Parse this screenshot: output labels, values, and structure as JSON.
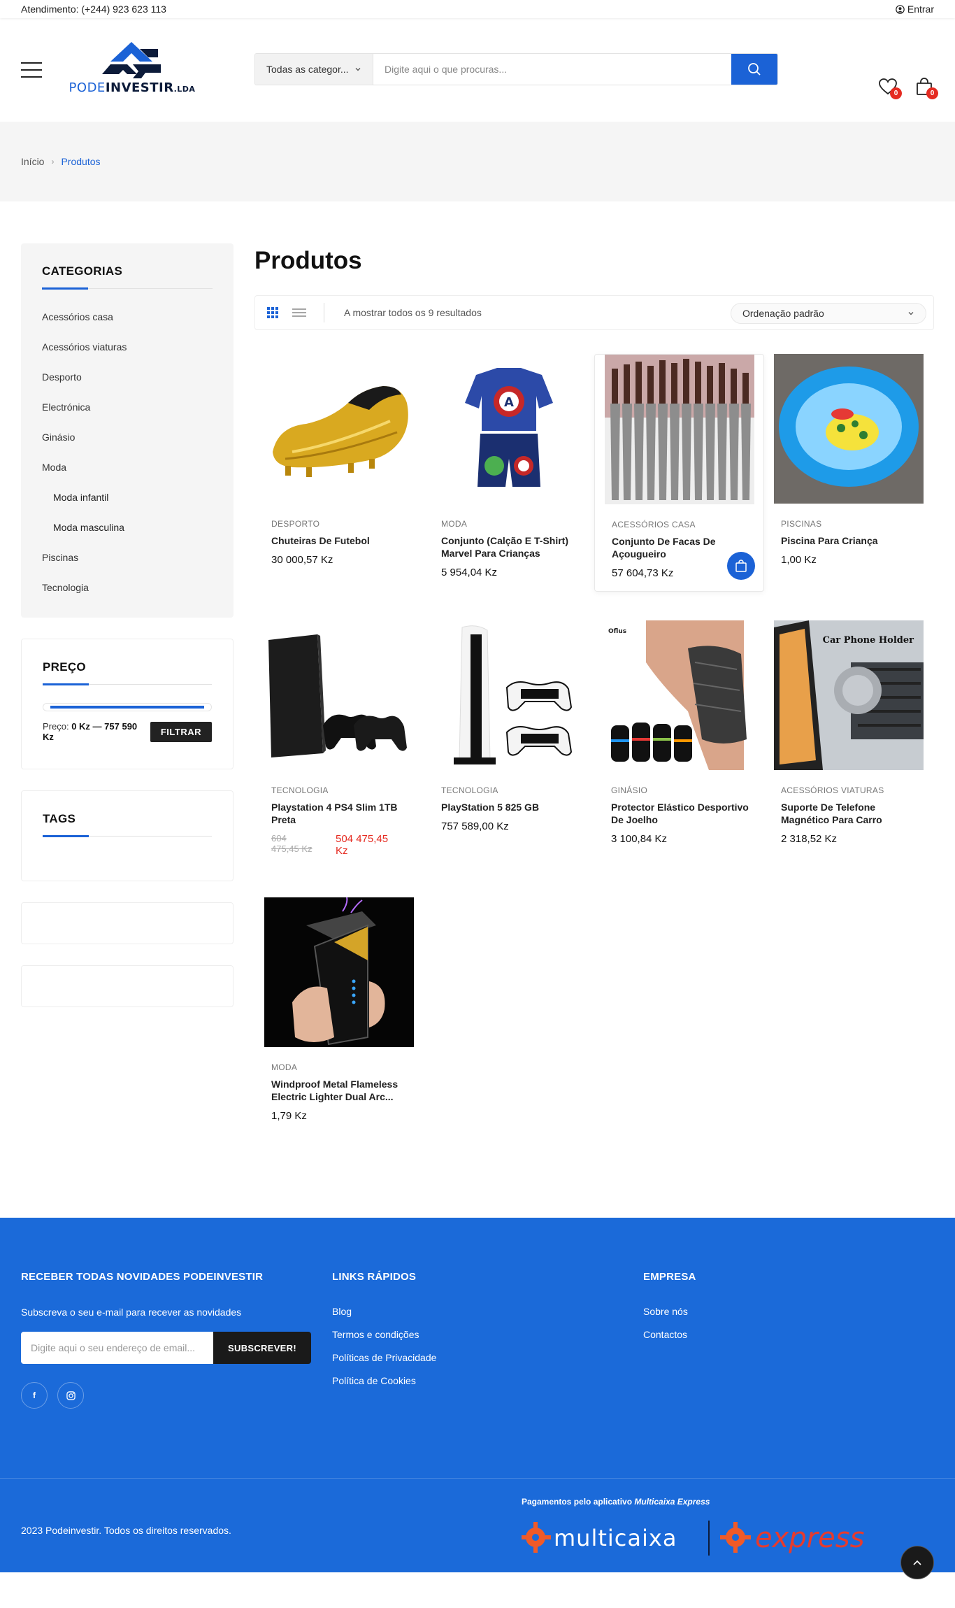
{
  "topbar": {
    "support": "Atendimento: (+244) 923 623 113",
    "login": "Entrar"
  },
  "header": {
    "logo": {
      "part1": "PODE",
      "part2": "INVESTIR",
      "part3": ".LDA"
    },
    "search": {
      "category": "Todas as categor...",
      "placeholder": "Digite aqui o que procuras..."
    },
    "wishlist_count": "0",
    "cart_count": "0"
  },
  "breadcrumb": {
    "home": "Início",
    "current": "Produtos"
  },
  "sidebar": {
    "categories_title": "CATEGORIAS",
    "categories": [
      {
        "label": "Acessórios casa",
        "sub": false
      },
      {
        "label": "Acessórios viaturas",
        "sub": false
      },
      {
        "label": "Desporto",
        "sub": false
      },
      {
        "label": "Electrónica",
        "sub": false
      },
      {
        "label": "Ginásio",
        "sub": false
      },
      {
        "label": "Moda",
        "sub": false
      },
      {
        "label": "Moda infantil",
        "sub": true
      },
      {
        "label": "Moda masculina",
        "sub": true
      },
      {
        "label": "Piscinas",
        "sub": false
      },
      {
        "label": "Tecnologia",
        "sub": false
      }
    ],
    "price_title": "PREÇO",
    "price_label": "Preço:",
    "price_range": "0 Kz — 757 590 Kz",
    "filter_button": "FILTRAR",
    "tags_title": "TAGS"
  },
  "main": {
    "title": "Produtos",
    "result_count": "A mostrar todos os 9 resultados",
    "sort": "Ordenação padrão"
  },
  "products": [
    {
      "category": "DESPORTO",
      "name": "Chuteiras De Futebol",
      "price": "30 000,57 Kz",
      "image": "golden-football-boot"
    },
    {
      "category": "MODA",
      "name": "Conjunto (Calção E T-Shirt) Marvel Para Crianças",
      "price": "5 954,04 Kz",
      "image": "marvel-kids-outfit"
    },
    {
      "category": "ACESSÓRIOS CASA",
      "name": "Conjunto De Facas De Açougueiro",
      "price": "57 604,73 Kz",
      "image": "knife-set"
    },
    {
      "category": "PISCINAS",
      "name": "Piscina Para Criança",
      "price": "1,00 Kz",
      "image": "kids-pool"
    },
    {
      "category": "TECNOLOGIA",
      "name": "Playstation 4 PS4 Slim 1TB Preta",
      "old_price": "604 475,45 Kz",
      "new_price": "504 475,45 Kz",
      "image": "ps4-slim"
    },
    {
      "category": "TECNOLOGIA",
      "name": "PlayStation 5 825 GB",
      "price": "757 589,00 Kz",
      "image": "ps5"
    },
    {
      "category": "GINÁSIO",
      "name": "Protector Elástico Desportivo De Joelho",
      "price": "3 100,84 Kz",
      "image": "knee-sleeve"
    },
    {
      "category": "ACESSÓRIOS VIATURAS",
      "name": "Suporte De Telefone Magnético Para Carro",
      "price": "2 318,52 Kz",
      "image": "car-phone-holder"
    },
    {
      "category": "MODA",
      "name": "Windproof Metal Flameless Electric Lighter Dual Arc...",
      "price": "1,79 Kz",
      "image": "electric-lighter"
    }
  ],
  "image_text": {
    "car_holder": "Car Phone Holder",
    "knee_brand": "Oflus"
  },
  "footer": {
    "newsletter_title": "RECEBER TODAS NOVIDADES PODEINVESTIR",
    "newsletter_text": "Subscreva o seu e-mail para recever as novidades",
    "email_placeholder": "Digite aqui o seu endereço de email...",
    "subscribe_button": "SUBSCREVER!",
    "links_title": "LINKS RÁPIDOS",
    "links": [
      "Blog",
      "Termos e condições",
      "Políticas de Privacidade",
      "Política de Cookies"
    ],
    "company_title": "EMPRESA",
    "company_links": [
      "Sobre nós",
      "Contactos"
    ],
    "copyright": "2023 Podeinvestir. Todos os direitos reservados.",
    "payments_label": "Pagamentos pelo aplicativo",
    "payments_app": "Multicaixa Express",
    "payment_logo_left": "multicaixa",
    "payment_logo_right": "express"
  },
  "colors": {
    "accent": "#1b62d6",
    "footer": "#1b6ad9",
    "sale": "#e52b21",
    "badge": "#e52b21"
  }
}
